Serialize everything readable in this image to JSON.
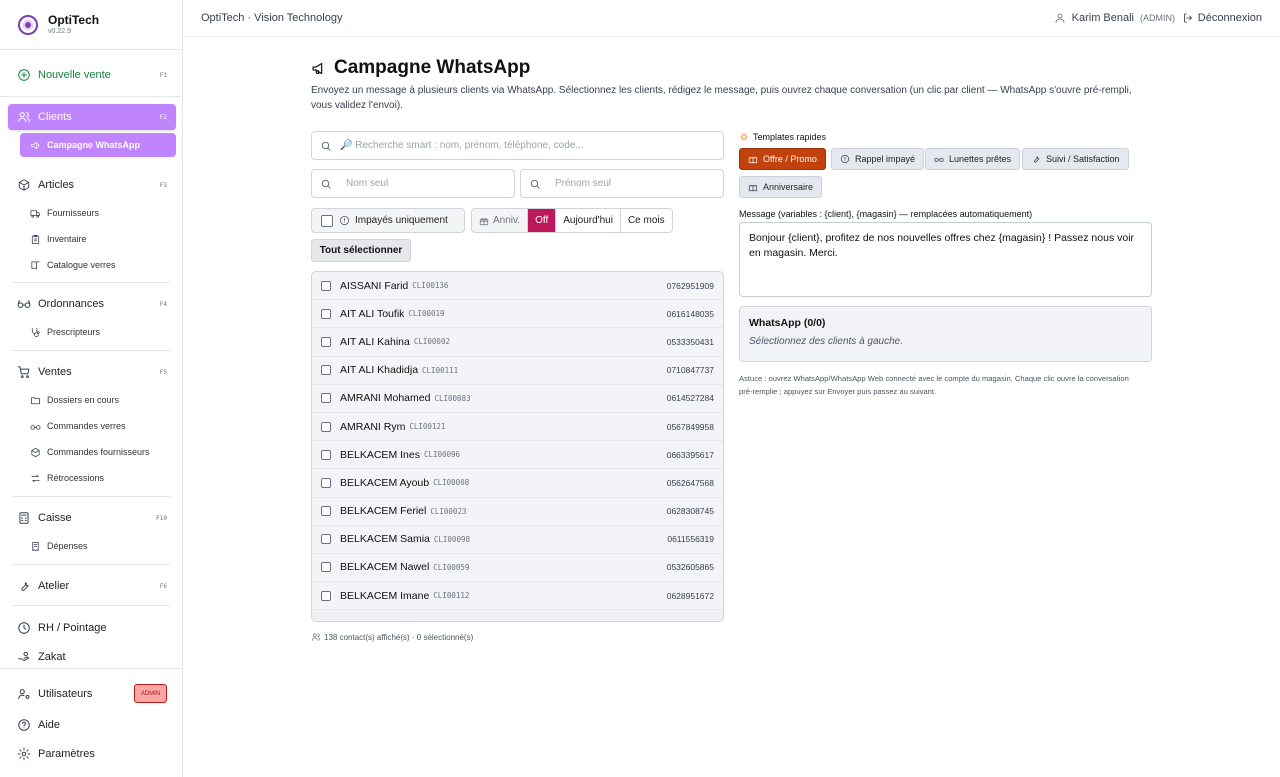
{
  "brand": {
    "name": "OptiTech",
    "version": "v0.22.9"
  },
  "sidebar": {
    "new_sale": {
      "label": "Nouvelle vente",
      "key": "F1"
    },
    "clients": {
      "label": "Clients",
      "key": "F2"
    },
    "clients_sub": [
      {
        "label": "Campagne WhatsApp",
        "icon": "megaphone-icon"
      }
    ],
    "articles": {
      "label": "Articles",
      "key": "F3"
    },
    "articles_sub": [
      {
        "label": "Fournisseurs",
        "icon": "truck-icon"
      },
      {
        "label": "Inventaire",
        "icon": "clipboard-icon"
      },
      {
        "label": "Catalogue verres",
        "icon": "book-icon"
      }
    ],
    "ordonnances": {
      "label": "Ordonnances",
      "key": "F4"
    },
    "ordonnances_sub": [
      {
        "label": "Prescripteurs",
        "icon": "stethoscope-icon"
      }
    ],
    "ventes": {
      "label": "Ventes",
      "key": "F5"
    },
    "ventes_sub": [
      {
        "label": "Dossiers en cours",
        "icon": "folder-icon"
      },
      {
        "label": "Commandes verres",
        "icon": "glasses-icon"
      },
      {
        "label": "Commandes fournisseurs",
        "icon": "package-icon"
      },
      {
        "label": "Rétrocessions",
        "icon": "arrows-icon"
      }
    ],
    "caisse": {
      "label": "Caisse",
      "key": "F10"
    },
    "caisse_sub": [
      {
        "label": "Dépenses",
        "icon": "receipt-icon"
      }
    ],
    "atelier": {
      "label": "Atelier",
      "key": "F6"
    },
    "rh": {
      "label": "RH / Pointage"
    },
    "zakat": {
      "label": "Zakat"
    },
    "utilisateurs": {
      "label": "Utilisateurs",
      "badge": "ADMIN"
    },
    "aide": {
      "label": "Aide"
    },
    "parametres": {
      "label": "Paramètres"
    }
  },
  "topbar": {
    "title": "OptiTech · Vision Technology",
    "user": "Karim Benali",
    "role": "(ADMIN)",
    "logout": "Déconnexion"
  },
  "page": {
    "title": "Campagne WhatsApp",
    "description": "Envoyez un message à plusieurs clients via WhatsApp. Sélectionnez les clients, rédigez le message, puis ouvrez chaque conversation (un clic par client — WhatsApp s'ouvre pré-rempli, vous validez l'envoi)."
  },
  "filters": {
    "search_placeholder": "🔎 Recherche smart : nom, prénom, téléphone, code...",
    "nom_placeholder": "Nom seul",
    "prenom_placeholder": "Prénom seul",
    "unpaid_label": "Impayés uniquement",
    "anniv_label": "Anniv.",
    "anniv_options": [
      "Off",
      "Aujourd'hui",
      "Ce mois"
    ],
    "anniv_selected": "Off",
    "select_all": "Tout sélectionner"
  },
  "clients": [
    {
      "name": "AISSANI Farid",
      "code": "CLI00136",
      "phone": "0762951909"
    },
    {
      "name": "AIT ALI Toufik",
      "code": "CLI00019",
      "phone": "0616148035"
    },
    {
      "name": "AIT ALI Kahina",
      "code": "CLI00002",
      "phone": "0533350431"
    },
    {
      "name": "AIT ALI Khadidja",
      "code": "CLI00111",
      "phone": "0710847737"
    },
    {
      "name": "AMRANI Mohamed",
      "code": "CLI00083",
      "phone": "0614527284"
    },
    {
      "name": "AMRANI Rym",
      "code": "CLI00121",
      "phone": "0567849958"
    },
    {
      "name": "BELKACEM Ines",
      "code": "CLI00096",
      "phone": "0663395617"
    },
    {
      "name": "BELKACEM Ayoub",
      "code": "CLI00008",
      "phone": "0562647568"
    },
    {
      "name": "BELKACEM Feriel",
      "code": "CLI00023",
      "phone": "0628308745"
    },
    {
      "name": "BELKACEM Samia",
      "code": "CLI00098",
      "phone": "0611556319"
    },
    {
      "name": "BELKACEM Nawel",
      "code": "CLI00059",
      "phone": "0532605865"
    },
    {
      "name": "BELKACEM Imane",
      "code": "CLI00112",
      "phone": "0628951672"
    }
  ],
  "list_footer": "138 contact(s) affiché(s) · 0 sélectionné(s)",
  "templates": {
    "title": "Templates rapides",
    "items": [
      "Offre / Promo",
      "Rappel impayé",
      "Lunettes prêtes",
      "Suivi / Satisfaction",
      "Anniversaire"
    ],
    "selected": "Offre / Promo"
  },
  "message": {
    "label": "Message (variables : {client}, {magasin} — remplacées automatiquement)",
    "value": "Bonjour {client}, profitez de nos nouvelles offres chez {magasin} ! Passez nous voir en magasin. Merci."
  },
  "whatsapp": {
    "title": "WhatsApp (0/0)",
    "empty": "Sélectionnez des clients à gauche."
  },
  "tip": "Astuce : ouvrez WhatsApp/WhatsApp Web connecté avec le compte du magasin. Chaque clic ouvre la conversation pré-remplie ; appuyez sur Envoyer puis passez au suivant.",
  "colors": {
    "accent": "#c084fc",
    "selected_template": "#c2410c",
    "toggle_on": "#be185d",
    "new_sale": "#15803d"
  }
}
